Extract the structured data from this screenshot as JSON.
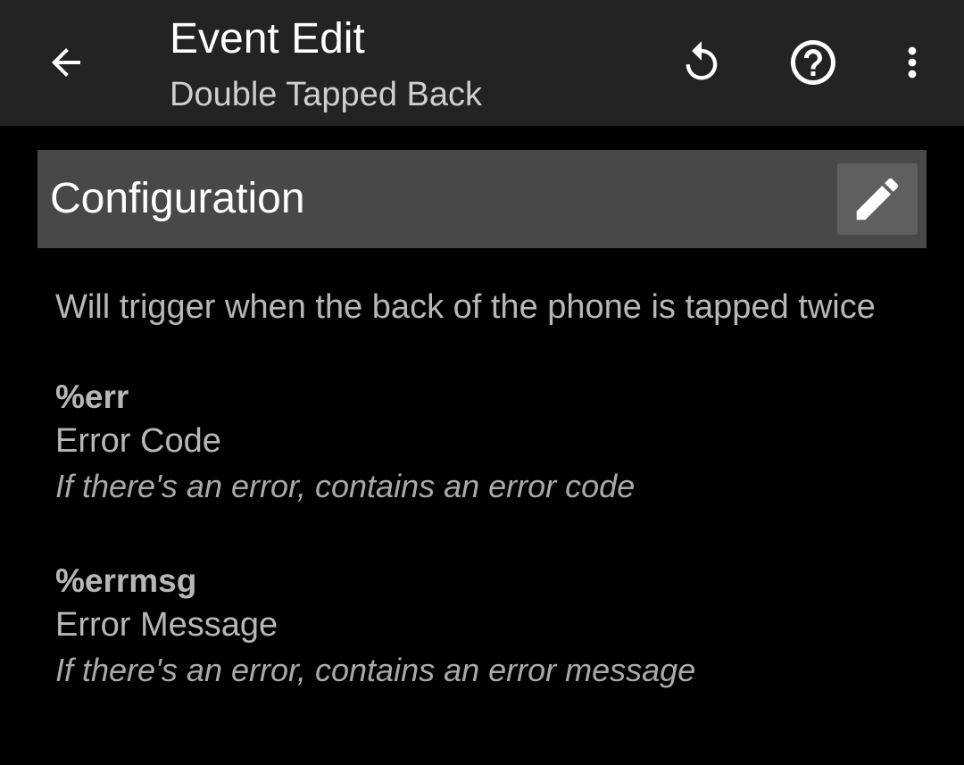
{
  "appbar": {
    "title": "Event Edit",
    "subtitle": "Double Tapped Back",
    "icons": {
      "back": "arrow-left-icon",
      "undo": "undo-icon",
      "help": "help-circle-icon",
      "more": "more-vertical-icon"
    }
  },
  "section": {
    "title": "Configuration",
    "edit_icon": "pencil-icon"
  },
  "description": "Will trigger when the back of the phone is tapped twice",
  "variables": [
    {
      "name": "%err",
      "label": "Error Code",
      "description": "If there's an error, contains an error code"
    },
    {
      "name": "%errmsg",
      "label": "Error Message",
      "description": "If there's an error, contains an error message"
    }
  ],
  "colors": {
    "appbar_bg": "#232323",
    "page_bg": "#000000",
    "section_header_bg": "#484848",
    "edit_button_bg": "#5f5f5f",
    "primary_text": "#ffffff",
    "secondary_text": "#b7b7b7"
  }
}
